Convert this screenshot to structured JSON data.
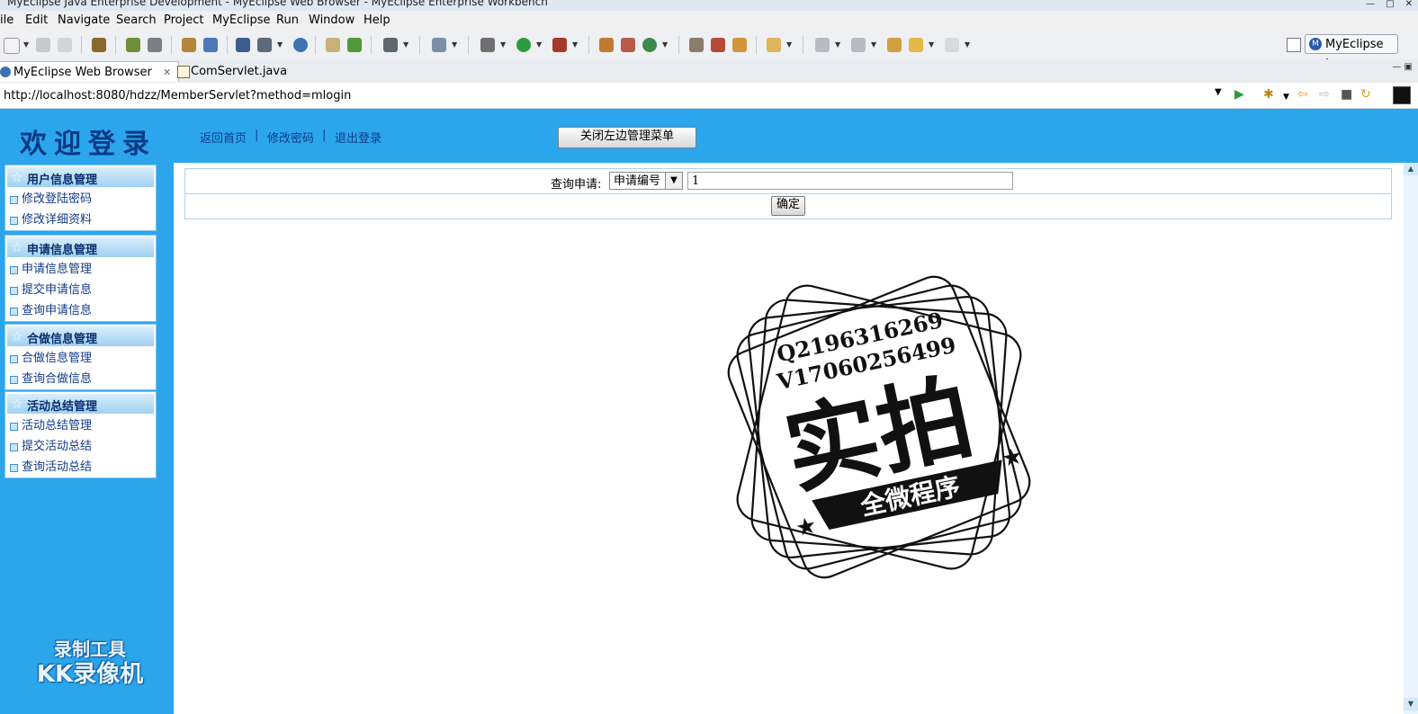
{
  "window": {
    "title": "MyEclipse Java Enterprise Development - MyEclipse Web Browser - MyEclipse Enterprise Workbench"
  },
  "menu": [
    "ile",
    "Edit",
    "Navigate",
    "Search",
    "Project",
    "MyEclipse",
    "Run",
    "Window",
    "Help"
  ],
  "perspective": {
    "label": "MyEclipse J..."
  },
  "tabs": [
    {
      "label": "MyEclipse Web Browser",
      "active": true
    },
    {
      "label": "ComServlet.java",
      "active": false
    }
  ],
  "browser": {
    "url": "http://localhost:8080/hdzz/MemberServlet?method=mlogin"
  },
  "header": {
    "welcome": "欢迎登录",
    "links": [
      "返回首页",
      "修改密码",
      "退出登录"
    ],
    "separator": "|",
    "close_menu_button": "关闭左边管理菜单"
  },
  "sidebar": {
    "groups": [
      {
        "title": "用户信息管理",
        "items": [
          "修改登陆密码",
          "修改详细资料"
        ]
      },
      {
        "title": "申请信息管理",
        "items": [
          "申请信息管理",
          "提交申请信息",
          "查询申请信息"
        ]
      },
      {
        "title": "合做信息管理",
        "items": [
          "合做信息管理",
          "查询合做信息"
        ]
      },
      {
        "title": "活动总结管理",
        "items": [
          "活动总结管理",
          "提交活动总结",
          "查询活动总结"
        ]
      }
    ]
  },
  "watermark": {
    "line1": "录制工具",
    "line2": "KK录像机"
  },
  "query": {
    "label": "查询申请:",
    "select_value": "申请编号",
    "input_value": "1",
    "submit_label": "确定"
  },
  "stamp": {
    "line1": "Q2196316269",
    "line2": "V17060256499",
    "big": "实拍",
    "banner": "全微程序"
  },
  "colors": {
    "header_bg": "#2ba6ec",
    "title_color": "#0a3a86",
    "link_color": "#123a88"
  }
}
